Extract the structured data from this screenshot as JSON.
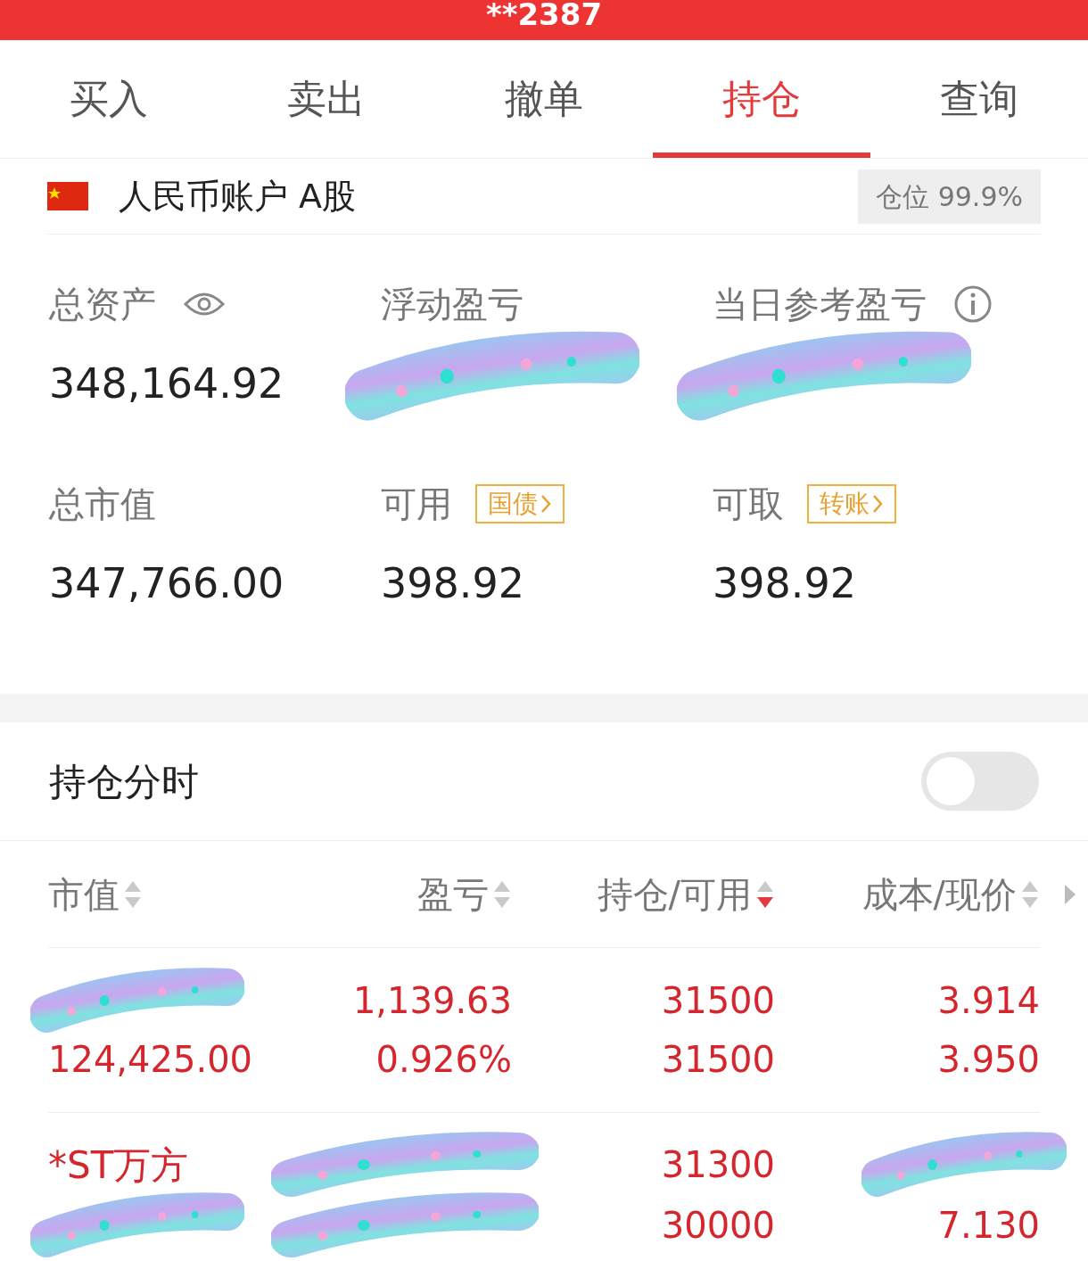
{
  "header": {
    "title": "**2387"
  },
  "tabs": [
    {
      "label": "买入",
      "selected": false
    },
    {
      "label": "卖出",
      "selected": false
    },
    {
      "label": "撤单",
      "selected": false
    },
    {
      "label": "持仓",
      "selected": true
    },
    {
      "label": "查询",
      "selected": false
    }
  ],
  "account": {
    "name": "人民币账户 A股",
    "position": "仓位 99.9%"
  },
  "summary": [
    {
      "label": "总资产",
      "kind": "eye",
      "value": "348,164.92"
    },
    {
      "label": "浮动盈亏",
      "kind": "plain"
    },
    {
      "label": "当日参考盈亏",
      "kind": "info"
    },
    {
      "label": "总市值",
      "kind": "plain",
      "value": "347,766.00"
    },
    {
      "label": "可用",
      "kind": "link",
      "link": "国债",
      "value": "398.92"
    },
    {
      "label": "可取",
      "kind": "link",
      "link": "转账",
      "value": "398.92"
    }
  ],
  "timeshare": {
    "label": "持仓分时",
    "on": false
  },
  "columns": [
    {
      "label": "市值",
      "sorted": false
    },
    {
      "label": "盈亏",
      "sorted": false
    },
    {
      "label": "持仓/可用",
      "sorted": true
    },
    {
      "label": "成本/现价",
      "sorted": false
    }
  ],
  "rows": [
    {
      "rising": true,
      "market_value": "124,425.00",
      "pl": "1,139.63",
      "pl_pct": "0.926%",
      "qty": "31500",
      "avail": "31500",
      "cost": "3.914",
      "price": "3.950"
    },
    {
      "rising": true,
      "name": "*ST万方",
      "qty": "31300",
      "avail": "30000",
      "price": "7.130"
    }
  ]
}
